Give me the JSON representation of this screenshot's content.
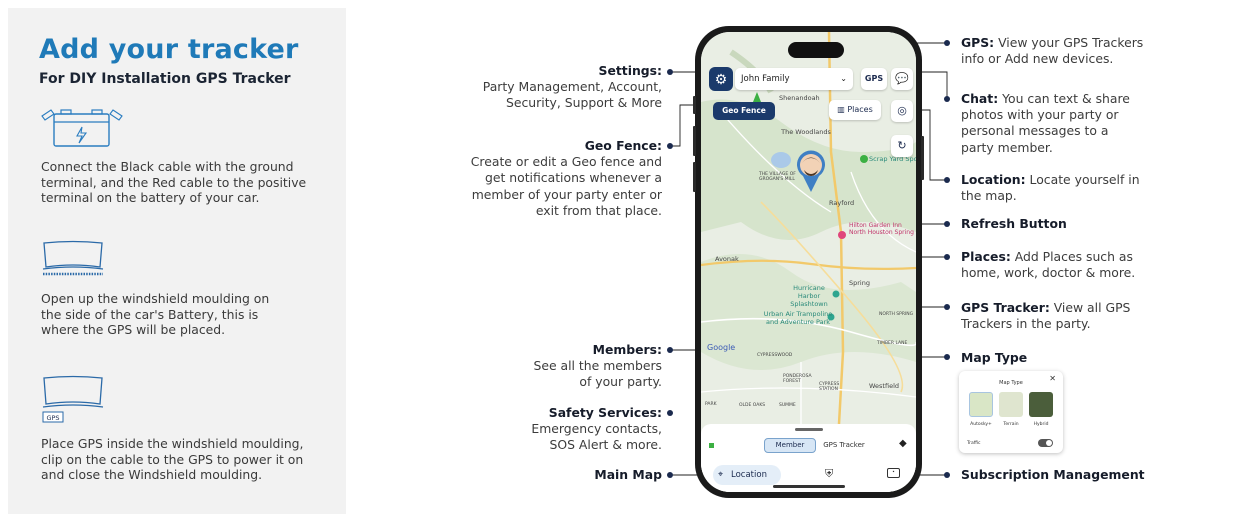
{
  "left": {
    "title": "Add your tracker",
    "subtitle": "For DIY Installation GPS Tracker",
    "steps": [
      {
        "icon": "car-battery-icon",
        "lines": [
          "Connect the Black cable with the ground",
          "terminal, and the Red cable to the positive",
          "terminal on the battery of your car."
        ]
      },
      {
        "icon": "windshield-moulding-icon",
        "lines": [
          "Open up the windshield moulding on",
          "the side of the car's Battery, this is",
          "where the GPS will be placed."
        ]
      },
      {
        "icon": "windshield-gps-icon",
        "badge": "GPS",
        "lines": [
          "Place GPS inside the windshield moulding,",
          "clip on the cable to the GPS to power it on",
          "and close the Windshield moulding."
        ]
      }
    ]
  },
  "annotations_left": {
    "settings": {
      "label": "Settings:",
      "lines": [
        "Party Management, Account,",
        "Security, Support & More"
      ]
    },
    "geofence": {
      "label": "Geo Fence:",
      "lines": [
        "Create or edit a Geo fence and",
        "get notifications whenever a",
        "member of your party enter or",
        "exit from that place."
      ]
    },
    "members": {
      "label": "Members:",
      "lines": [
        "See all the members",
        "of your party."
      ]
    },
    "safety": {
      "label": "Safety Services:",
      "lines": [
        "Emergency contacts,",
        "SOS Alert & more."
      ]
    },
    "main_map": {
      "label": "Main Map"
    }
  },
  "annotations_right": {
    "gps": {
      "label": "GPS:",
      "first": " View your GPS Trackers",
      "lines": [
        "info or Add new devices."
      ]
    },
    "chat": {
      "label": "Chat:",
      "first": " You can text & share",
      "lines": [
        "photos with your party or",
        "personal messages to a",
        "party member."
      ]
    },
    "location": {
      "label": "Location:",
      "first": " Locate yourself in",
      "lines": [
        "the map."
      ]
    },
    "refresh": {
      "label": "Refresh Button"
    },
    "places": {
      "label": "Places:",
      "first": " Add Places such as",
      "lines": [
        "home, work, doctor & more."
      ]
    },
    "gps_tracker": {
      "label": "GPS Tracker:",
      "first": " View all GPS",
      "lines": [
        "Trackers in the party."
      ]
    },
    "map_type": {
      "label": "Map Type"
    },
    "subscription": {
      "label": "Subscription Management"
    }
  },
  "phone": {
    "party_name": "John Family",
    "gps_button": "GPS",
    "geofence_button": "Geo Fence",
    "places_button": "Places",
    "member_tab": "Member",
    "gps_tracker_tab": "GPS Tracker",
    "location_nav": "Location",
    "map_labels": {
      "shenandoah": "Shenandoah",
      "the_woodlands": "The Woodlands",
      "the_village": "THE VILLAGE OF GROGAN'S MILL",
      "scrap_yard": "Scrap Yard Spo",
      "rayford": "Rayford",
      "hilton": "Hilton Garden Inn North Houston Spring",
      "avonak": "Avonak",
      "hurricane": "Hurricane Harbor Splashtown",
      "spring": "Spring",
      "urban_air": "Urban Air Trampoline and Adventure Park",
      "north_spring": "NORTH SPRING",
      "google": "Google",
      "cypresswood": "CYPRESSWOOD",
      "timber_lane": "TIMBER LANE",
      "westfield": "Westfield",
      "ponderosa": "PONDEROSA FOREST",
      "cypress_station": "CYPRESS STATION",
      "park": "PARK",
      "olde_oaks": "OLDE OAKS",
      "summe": "SUMME"
    }
  },
  "map_type_card": {
    "title": "Map Type",
    "options": [
      "Autosky+",
      "Terrain",
      "Hybrid"
    ],
    "traffic_label": "Traffic"
  },
  "colors": {
    "title_blue": "#1f7ab8",
    "navy": "#1b3a6b",
    "dot": "#1b2a4e"
  }
}
